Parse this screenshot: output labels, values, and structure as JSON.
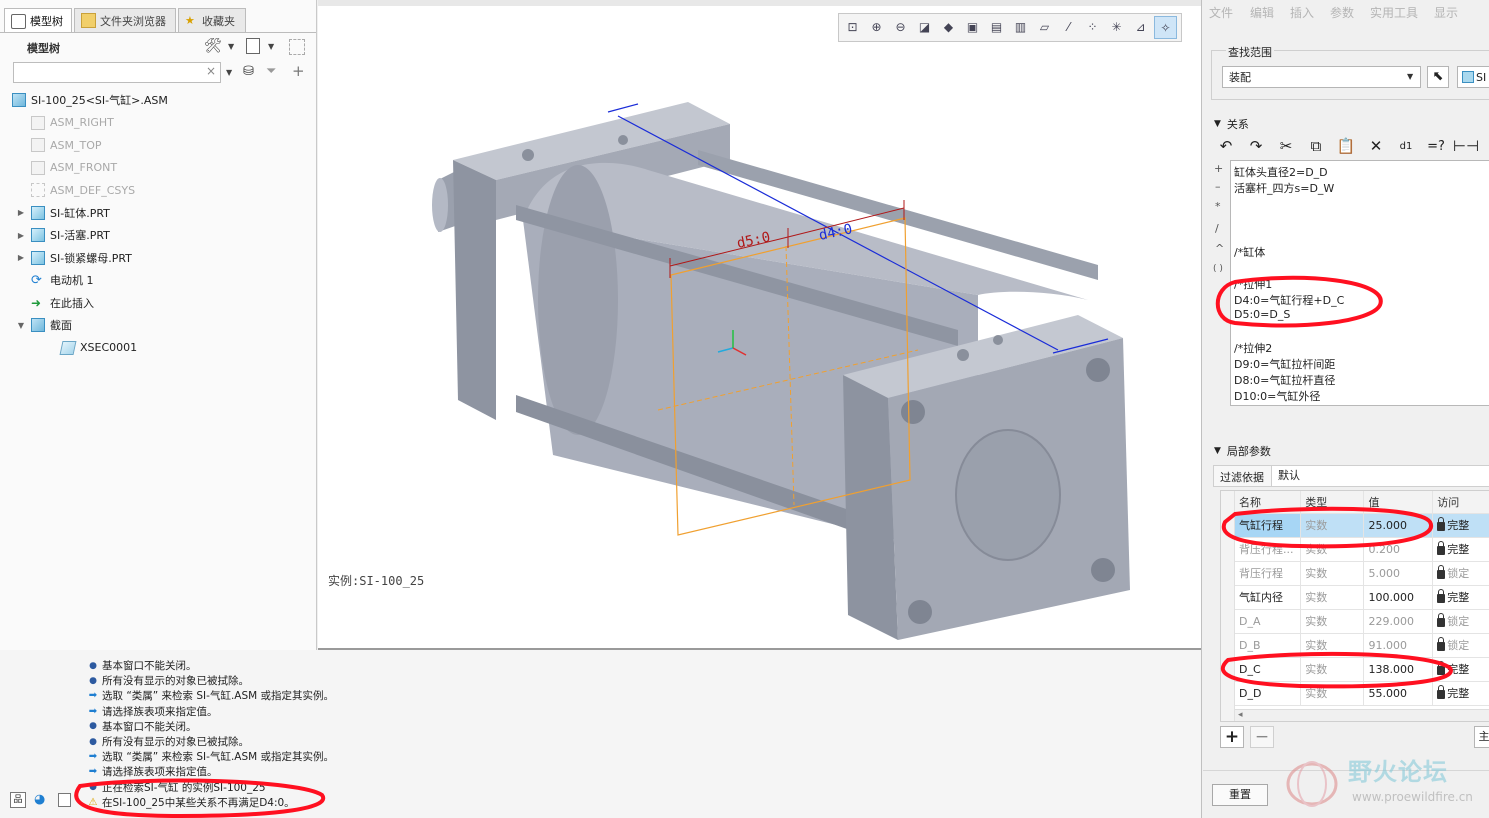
{
  "tabs": [
    {
      "label": "模型树"
    },
    {
      "label": "文件夹浏览器"
    },
    {
      "label": "收藏夹"
    }
  ],
  "model_tree": {
    "header": "模型树",
    "items": [
      {
        "label": "SI-100_25<SI-气缸>.ASM",
        "icon": "assembly-icon",
        "level": 0,
        "dim": false
      },
      {
        "label": "ASM_RIGHT",
        "icon": "datum-plane-icon",
        "level": 1,
        "dim": true
      },
      {
        "label": "ASM_TOP",
        "icon": "datum-plane-icon",
        "level": 1,
        "dim": true
      },
      {
        "label": "ASM_FRONT",
        "icon": "datum-plane-icon",
        "level": 1,
        "dim": true
      },
      {
        "label": "ASM_DEF_CSYS",
        "icon": "csys-icon",
        "level": 1,
        "dim": true
      },
      {
        "label": "SI-缸体.PRT",
        "icon": "part-icon",
        "level": 1,
        "dim": false,
        "expandable": true
      },
      {
        "label": "SI-活塞.PRT",
        "icon": "part-icon",
        "level": 1,
        "dim": false,
        "expandable": true
      },
      {
        "label": "SI-锁紧螺母.PRT",
        "icon": "part-icon",
        "level": 1,
        "dim": false,
        "expandable": true
      },
      {
        "label": "电动机 1",
        "icon": "motor-icon",
        "level": 1,
        "dim": false
      },
      {
        "label": "在此插入",
        "icon": "insert-arrow-icon",
        "level": 1,
        "dim": false
      },
      {
        "label": "截面",
        "icon": "section-folder-icon",
        "level": 1,
        "dim": false,
        "expanded": true
      },
      {
        "label": "XSEC0001",
        "icon": "section-icon",
        "level": 2,
        "dim": false
      }
    ]
  },
  "viewport": {
    "instance_label": "实例:SI-100_25",
    "dim_labels": {
      "d5": "d5:0",
      "d4": "d4:0"
    }
  },
  "messages": [
    {
      "type": "bullet",
      "text": "基本窗口不能关闭。"
    },
    {
      "type": "bullet",
      "text": "所有没有显示的对象已被拭除。"
    },
    {
      "type": "arrow",
      "text": "选取 “类属” 来检索 SI-气缸.ASM  或指定其实例。"
    },
    {
      "type": "arrow",
      "text": "请选择族表项来指定值。"
    },
    {
      "type": "bullet",
      "text": "基本窗口不能关闭。"
    },
    {
      "type": "bullet",
      "text": "所有没有显示的对象已被拭除。"
    },
    {
      "type": "arrow",
      "text": "选取 “类属” 来检索 SI-气缸.ASM  或指定其实例。"
    },
    {
      "type": "arrow",
      "text": "请选择族表项来指定值。"
    },
    {
      "type": "bullet",
      "text": "正在检索SI-气缸 的实例SI-100_25"
    },
    {
      "type": "warning",
      "text": "在SI-100_25中某些关系不再满足D4:0。"
    }
  ],
  "right_panel": {
    "menu": [
      "文件",
      "编辑",
      "插入",
      "参数",
      "实用工具",
      "显示"
    ],
    "search_scope_label": "查找范围",
    "search_scope_value": "装配",
    "scope_button_label": "SI",
    "relations_header": "关系",
    "relations": [
      "缸体头直径2=D_D",
      "活塞杆_四方s=D_W",
      "",
      "",
      "",
      "/*缸体",
      "",
      "/*拉伸1",
      "D4:0=气缸行程+D_C",
      "D5:0=D_S",
      "",
      "/*拉伸2",
      "D9:0=气缸拉杆间距",
      "D8:0=气缸拉杆直径",
      "D10:0=气缸外径"
    ],
    "local_params_header": "局部参数",
    "filter_label": "过滤依据",
    "filter_value": "默认",
    "table_headers": [
      "名称",
      "类型",
      "值",
      "访问"
    ],
    "params": [
      {
        "name": "气缸行程",
        "type": "实数",
        "value": "25.000",
        "access": "完整",
        "selected": true
      },
      {
        "name": "背压行程...",
        "type": "实数",
        "value": "0.200",
        "access": "完整",
        "muted": true
      },
      {
        "name": "背压行程",
        "type": "实数",
        "value": "5.000",
        "access": "锁定",
        "muted": true
      },
      {
        "name": "气缸内径",
        "type": "实数",
        "value": "100.000",
        "access": "完整",
        "muted": false
      },
      {
        "name": "D_A",
        "type": "实数",
        "value": "229.000",
        "access": "锁定",
        "muted": true
      },
      {
        "name": "D_B",
        "type": "实数",
        "value": "91.000",
        "access": "锁定",
        "muted": true
      },
      {
        "name": "D_C",
        "type": "实数",
        "value": "138.000",
        "access": "完整",
        "muted": false
      },
      {
        "name": "D_D",
        "type": "实数",
        "value": "55.000",
        "access": "完整",
        "muted": false
      }
    ],
    "reset_label": "重置",
    "more_label": "主"
  },
  "watermark": {
    "title": "野火论坛",
    "url": "www.proewildfire.cn"
  },
  "colors": {
    "model": "#aab0bd",
    "annotation": "#ff1020",
    "accent_blue": "#1f7fd1",
    "dim_red": "#b01818",
    "dim_orange": "#f0a030"
  }
}
